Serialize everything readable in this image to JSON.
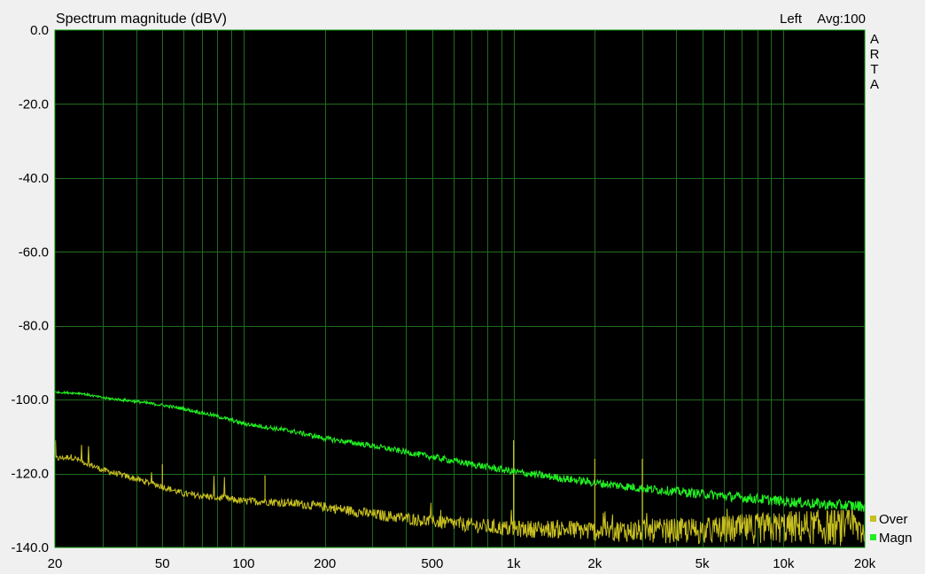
{
  "header": {
    "title": "Spectrum magnitude (dBV)",
    "channel": "Left",
    "avg": "Avg:100"
  },
  "brand": [
    "A",
    "R",
    "T",
    "A"
  ],
  "colors": {
    "plot_bg": "#000000",
    "grid": "#1f6b1f",
    "frame": "#009000",
    "magn": "#22ee22",
    "over": "#c8c020"
  },
  "chart_data": {
    "type": "line",
    "title": "Spectrum magnitude (dBV)",
    "xscale": "log",
    "xlim": [
      20,
      20000
    ],
    "ylim": [
      -140,
      0
    ],
    "grid": true,
    "legend_position": "bottom-right",
    "x_ticks": [
      {
        "value": 20,
        "label": "20"
      },
      {
        "value": 50,
        "label": "50"
      },
      {
        "value": 100,
        "label": "100"
      },
      {
        "value": 200,
        "label": "200"
      },
      {
        "value": 500,
        "label": "500"
      },
      {
        "value": 1000,
        "label": "1k"
      },
      {
        "value": 2000,
        "label": "2k"
      },
      {
        "value": 5000,
        "label": "5k"
      },
      {
        "value": 10000,
        "label": "10k"
      },
      {
        "value": 20000,
        "label": "20k"
      }
    ],
    "y_ticks": [
      {
        "value": 0,
        "label": "0.0"
      },
      {
        "value": -20,
        "label": "-20.0"
      },
      {
        "value": -40,
        "label": "-40.0"
      },
      {
        "value": -60,
        "label": "-60.0"
      },
      {
        "value": -80,
        "label": "-80.0"
      },
      {
        "value": -100,
        "label": "-100.0"
      },
      {
        "value": -120,
        "label": "-120.0"
      },
      {
        "value": -140,
        "label": "-140.0"
      }
    ],
    "series": [
      {
        "name": "Magn",
        "color": "#22ee22",
        "x": [
          20,
          25,
          30,
          40,
          50,
          60,
          80,
          100,
          150,
          200,
          300,
          500,
          700,
          1000,
          2000,
          3000,
          5000,
          7000,
          10000,
          15000,
          20000
        ],
        "y": [
          -98,
          -98.3,
          -99.5,
          -100.5,
          -101.5,
          -102.5,
          -104.5,
          -106.5,
          -108.5,
          -110.5,
          -112.5,
          -115.5,
          -117.5,
          -119.5,
          -122.5,
          -124,
          -125.5,
          -126.5,
          -127.5,
          -128.5,
          -128.8
        ]
      },
      {
        "name": "Over",
        "color": "#c8c020",
        "x": [
          20,
          23,
          30,
          40,
          50,
          60,
          80,
          100,
          120,
          150,
          200,
          300,
          500,
          700,
          1000,
          1500,
          2000,
          3000,
          5000,
          7000,
          10000,
          15000,
          20000
        ],
        "y": [
          -116,
          -115.5,
          -119,
          -121.5,
          -123.5,
          -125.5,
          -126.5,
          -127.5,
          -127.5,
          -128,
          -129,
          -131,
          -133,
          -134,
          -135,
          -135,
          -135.5,
          -135.5,
          -135.5,
          -135,
          -134.5,
          -134.5,
          -135
        ]
      }
    ],
    "spikes": [
      {
        "series": "Over",
        "x": 50,
        "y": -117.5
      },
      {
        "series": "Over",
        "x": 120,
        "y": -120.5
      },
      {
        "series": "Over",
        "x": 1000,
        "y": -111
      },
      {
        "series": "Over",
        "x": 2000,
        "y": -116
      },
      {
        "series": "Over",
        "x": 3000,
        "y": -116
      }
    ]
  }
}
